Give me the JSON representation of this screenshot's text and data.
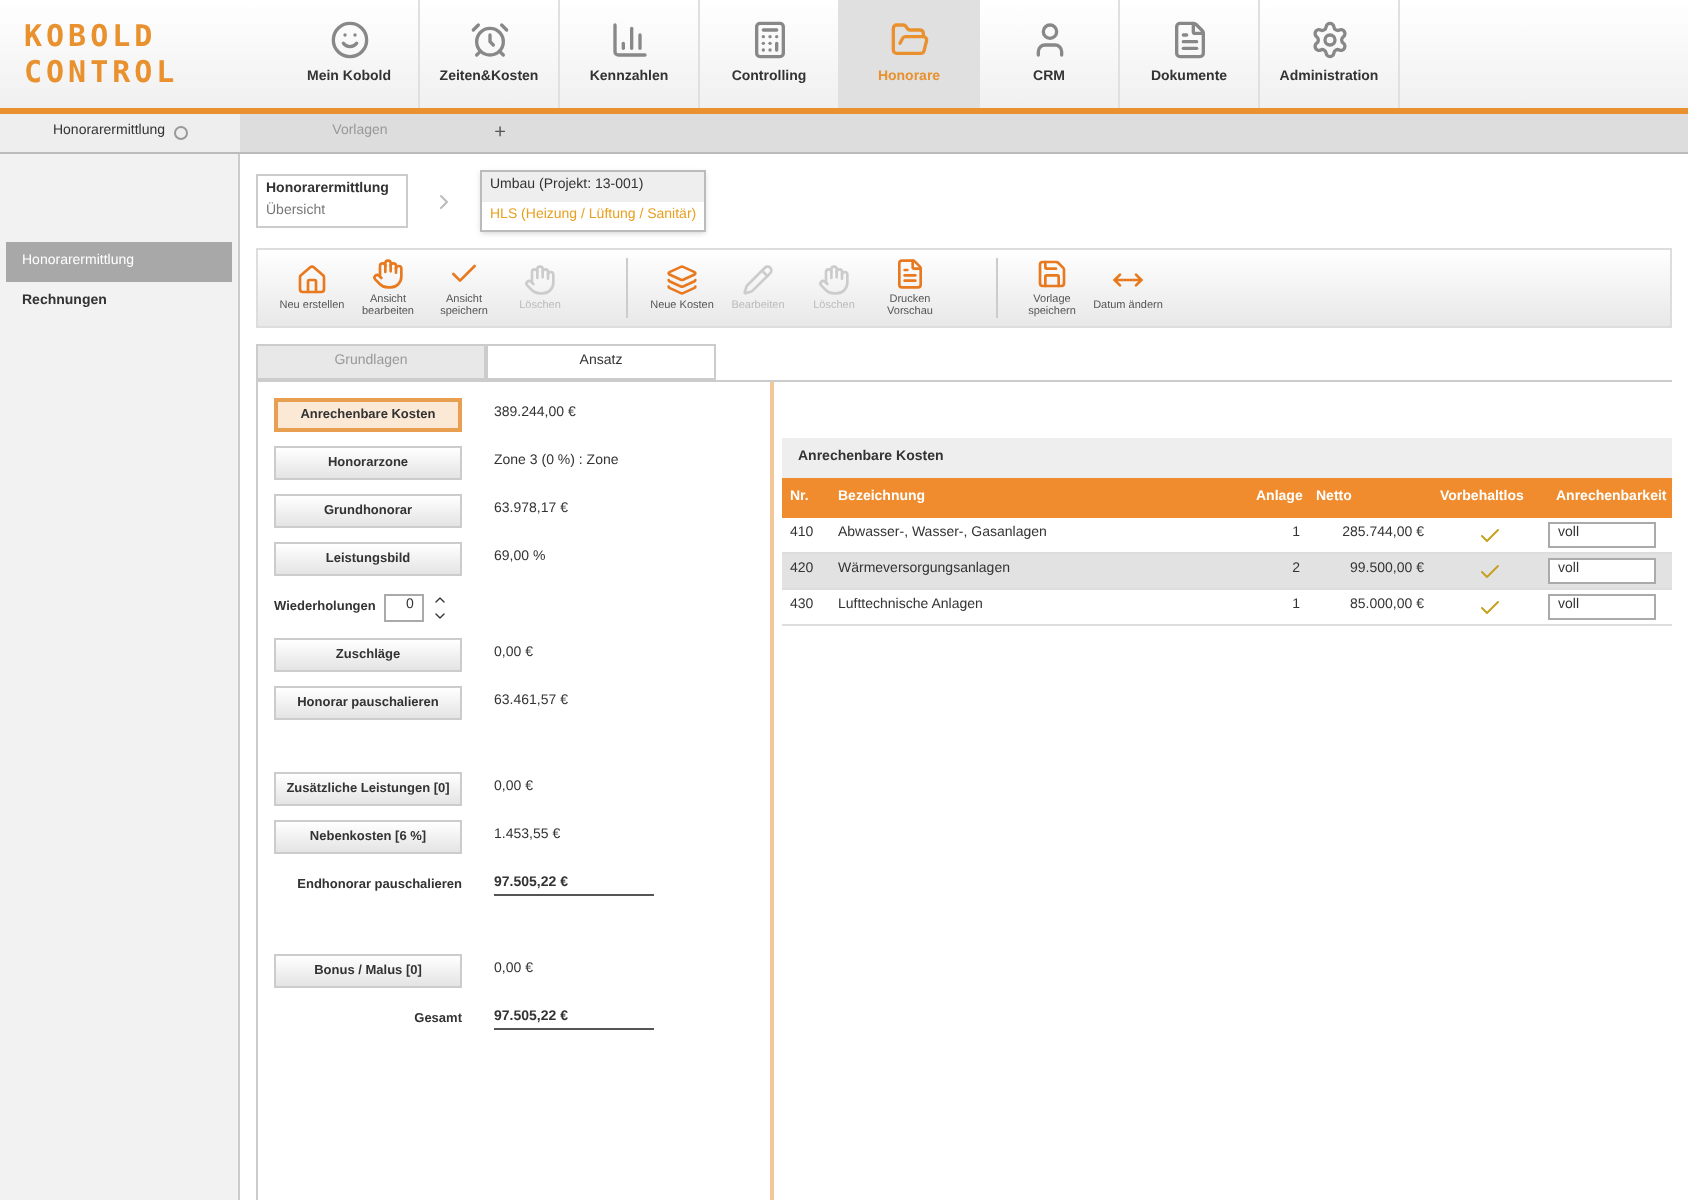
{
  "logo": {
    "line1": "KOBOLD",
    "line2": "CONTROL"
  },
  "nav": [
    {
      "label": "Mein Kobold",
      "selected": false
    },
    {
      "label": "Zeiten&Kosten",
      "selected": false
    },
    {
      "label": "Kennzahlen",
      "selected": false
    },
    {
      "label": "Controlling",
      "selected": false
    },
    {
      "label": "Honorare",
      "selected": true
    },
    {
      "label": "CRM",
      "selected": false
    },
    {
      "label": "Dokumente",
      "selected": false
    },
    {
      "label": "Administration",
      "selected": false
    }
  ],
  "tabs": [
    {
      "label": "Honorarermittlung",
      "selected": true
    },
    {
      "label": "Vorlagen",
      "selected": false
    }
  ],
  "add_tab": "+",
  "sidebar": {
    "items": [
      {
        "label": "Honorarermittlung",
        "selected": true
      },
      {
        "label": "Rechnungen",
        "selected": false
      }
    ]
  },
  "breadcrumb": {
    "title": "Honorarermittlung",
    "subtitle": "Übersicht",
    "project": "Umbau (Projekt: 13-001)",
    "discipline": "HLS (Heizung / Lüftung / Sanitär)"
  },
  "toolbar": [
    {
      "label": "Neu erstellen",
      "disabled": false
    },
    {
      "label": "Ansicht bearbeiten",
      "disabled": false
    },
    {
      "label": "Ansicht speichern",
      "disabled": false
    },
    {
      "label": "Löschen",
      "disabled": true
    },
    {
      "label": "Neue Kosten",
      "disabled": false
    },
    {
      "label": "Bearbeiten",
      "disabled": true
    },
    {
      "label": "Löschen",
      "disabled": true
    },
    {
      "label": "Drucken Vorschau",
      "disabled": false
    },
    {
      "label": "Vorlage speichern",
      "disabled": false
    },
    {
      "label": "Datum ändern",
      "disabled": false
    }
  ],
  "sub_tabs": [
    {
      "label": "Grundlagen",
      "selected": false
    },
    {
      "label": "Ansatz",
      "selected": true
    }
  ],
  "calc_rows": [
    {
      "kind": "button",
      "label": "Anrechenbare Kosten",
      "value": "389.244,00 €",
      "selected": true
    },
    {
      "kind": "button",
      "label": "Honorarzone",
      "value": "Zone 3 (0 %) : Zone",
      "selected": false
    },
    {
      "kind": "button",
      "label": "Grundhonorar",
      "value": "63.978,17 €",
      "selected": false
    },
    {
      "kind": "button",
      "label": "Leistungsbild",
      "value": "69,00 %",
      "selected": false
    },
    {
      "kind": "spinner",
      "label": "Wiederholungen",
      "value": "0"
    },
    {
      "kind": "button",
      "label": "Zuschläge",
      "value": "0,00 €",
      "selected": false
    },
    {
      "kind": "button",
      "label": "Honorar pauschalieren",
      "value": "63.461,57 €",
      "selected": false
    },
    {
      "kind": "gap"
    },
    {
      "kind": "button",
      "label": "Zusätzliche Leistungen [0]",
      "value": "0,00 €",
      "selected": false
    },
    {
      "kind": "button",
      "label": "Nebenkosten [6 %]",
      "value": "1.453,55 €",
      "selected": false
    },
    {
      "kind": "total",
      "label": "Endhonorar pauschalieren",
      "value": "97.505,22 €"
    },
    {
      "kind": "gap"
    },
    {
      "kind": "button",
      "label": "Bonus / Malus [0]",
      "value": "0,00 €",
      "selected": false
    },
    {
      "kind": "total",
      "label": "Gesamt",
      "value": "97.505,22 €"
    }
  ],
  "cost_table": {
    "title": "Anrechenbare Kosten",
    "columns": [
      "Nr.",
      "Bezeichnung",
      "Anlage",
      "Netto",
      "Vorbehaltlos",
      "Anrechenbarkeit"
    ],
    "rows": [
      {
        "nr": "410",
        "name": "Abwasser-, Wasser-, Gasanlagen",
        "anlage": "1",
        "netto": "285.744,00 €",
        "checked": true,
        "select": "voll",
        "selected": false
      },
      {
        "nr": "420",
        "name": "Wärmeversorgungsanlagen",
        "anlage": "2",
        "netto": "99.500,00 €",
        "checked": true,
        "select": "voll",
        "selected": true
      },
      {
        "nr": "430",
        "name": "Lufttechnische Anlagen",
        "anlage": "1",
        "netto": "85.000,00 €",
        "checked": true,
        "select": "voll",
        "selected": false
      }
    ]
  }
}
